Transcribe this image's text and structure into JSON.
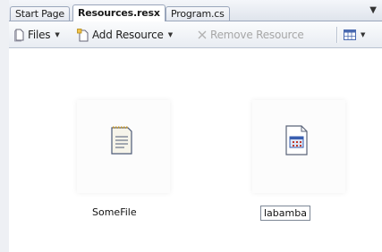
{
  "tabs": [
    {
      "label": "Start Page",
      "active": false
    },
    {
      "label": "Resources.resx",
      "active": true
    },
    {
      "label": "Program.cs",
      "active": false
    }
  ],
  "tab_menu_icon": "dropdown-arrow-icon",
  "toolbar": {
    "files_label": "Files",
    "add_resource_label": "Add Resource",
    "remove_resource_label": "Remove Resource",
    "remove_enabled": false
  },
  "resources": [
    {
      "name": "SomeFile",
      "icon": "text-file-icon",
      "editing": false
    },
    {
      "name": "labamba",
      "icon": "file-grid-icon",
      "editing": true
    }
  ],
  "colors": {
    "tab_border": "#9aa6bb",
    "disabled_text": "#a7a7a7",
    "grid_icon_blue": "#3a5fb0"
  }
}
